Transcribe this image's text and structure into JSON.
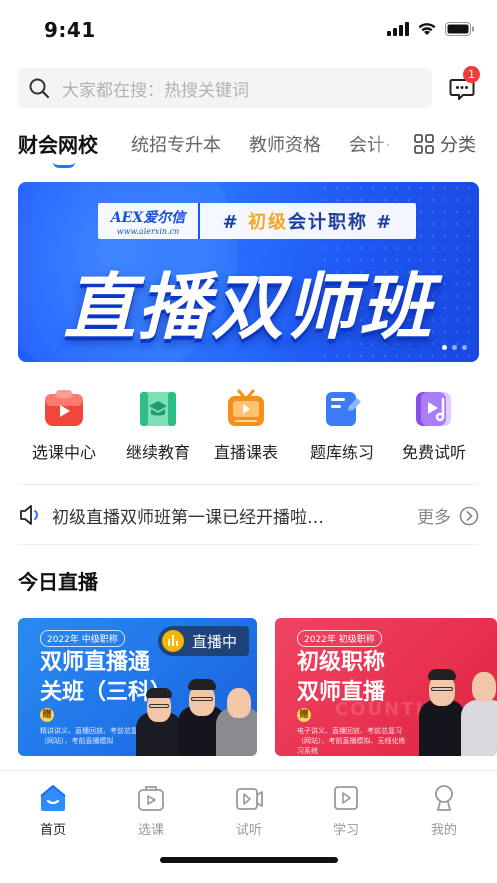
{
  "status_bar": {
    "time": "9:41"
  },
  "search": {
    "placeholder": "大家都在搜：热搜关键词",
    "message_badge": "1"
  },
  "tabs": [
    {
      "label": "财会网校",
      "active": true
    },
    {
      "label": "统招专升本"
    },
    {
      "label": "教师资格"
    },
    {
      "label": "会计·"
    }
  ],
  "category_label": "分类",
  "banner": {
    "logo_text": "AEX爱尔信",
    "logo_url_text": "www.aierxin.cn",
    "tag_prefix": "# ",
    "tag_highlight": "初级",
    "tag_suffix": "会计职称 #",
    "title": "直播双师班"
  },
  "quick_nav": [
    {
      "label": "选课中心",
      "icon": "course-select-icon",
      "color": "#f2463c"
    },
    {
      "label": "继续教育",
      "icon": "continuing-education-icon",
      "color": "#2dbd87"
    },
    {
      "label": "直播课表",
      "icon": "live-schedule-icon",
      "color": "#f5901e"
    },
    {
      "label": "题库练习",
      "icon": "question-bank-icon",
      "color": "#3b7cf6"
    },
    {
      "label": "免费试听",
      "icon": "free-trial-icon",
      "color": "#8a4df0"
    }
  ],
  "notice": {
    "text": "初级直播双师班第一课已经开播啦…",
    "more_label": "更多"
  },
  "today_live": {
    "title": "今日直播",
    "cards": [
      {
        "year_tag": "2022年 中级职称",
        "title": "双师直播通\n关班（三科）",
        "gift": "赠",
        "desc": "精讲讲义、直播回放、考前总复习（网站）、考前直播模拟",
        "live_badge": "直播中"
      },
      {
        "year_tag": "2022年 初级职称",
        "title": "初级职称\n双师直播",
        "gift": "赠",
        "desc": "电子讲义、直播回放、考前总复习（网站）、考前直播模拟、无线化练习系统",
        "watermark": "COUNTING"
      }
    ]
  },
  "tabbar": [
    {
      "label": "首页",
      "icon": "home-icon",
      "active": true
    },
    {
      "label": "选课",
      "icon": "course-bag-icon"
    },
    {
      "label": "试听",
      "icon": "trial-video-icon"
    },
    {
      "label": "学习",
      "icon": "study-play-icon"
    },
    {
      "label": "我的",
      "icon": "profile-icon"
    }
  ]
}
